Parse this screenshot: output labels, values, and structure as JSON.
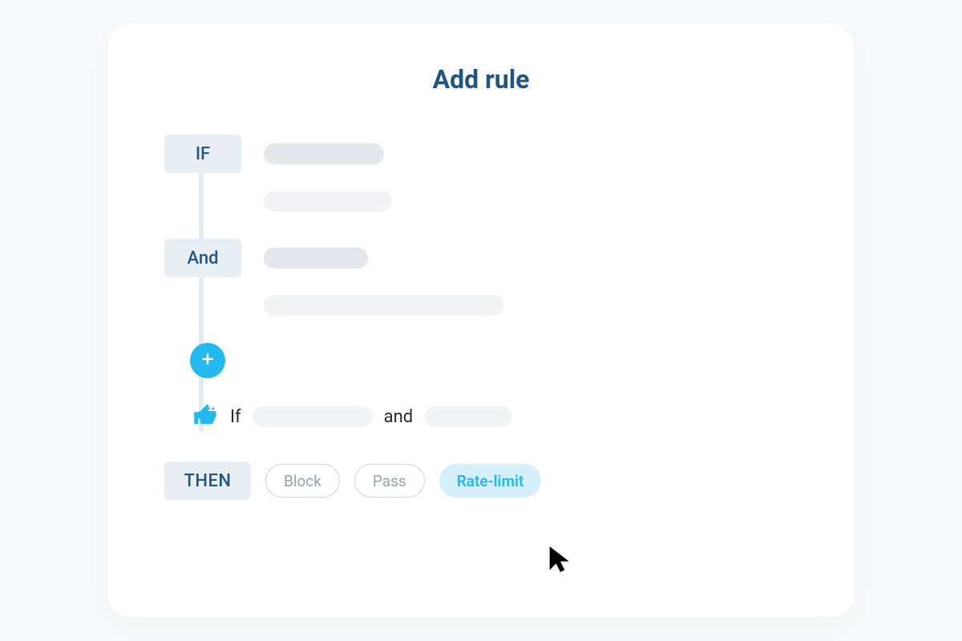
{
  "title": "Add rule",
  "conditions": {
    "if_label": "IF",
    "and_label": "And",
    "then_label": "THEN"
  },
  "summary": {
    "if_word": "If",
    "and_word": "and"
  },
  "actions": {
    "block": "Block",
    "pass": "Pass",
    "rate_limit": "Rate-limit",
    "selected": "rate_limit"
  }
}
